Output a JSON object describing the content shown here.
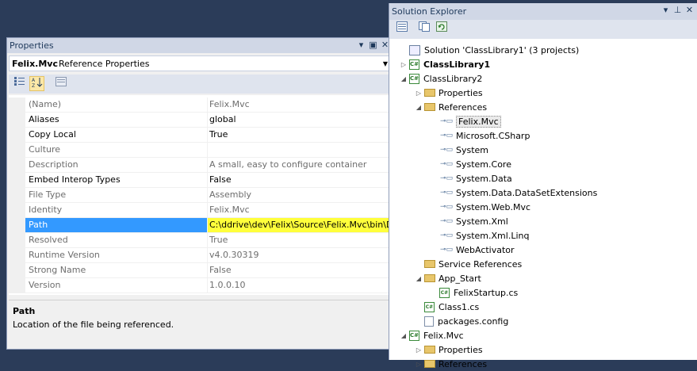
{
  "properties": {
    "title": "Properties",
    "window_buttons": [
      "▾",
      "▣",
      "✕"
    ],
    "object_name": "Felix.Mvc",
    "object_type": "Reference Properties",
    "rows": [
      {
        "name": "(Name)",
        "value": "Felix.Mvc",
        "readonly": true
      },
      {
        "name": "Aliases",
        "value": "global",
        "readonly": false
      },
      {
        "name": "Copy Local",
        "value": "True",
        "readonly": false
      },
      {
        "name": "Culture",
        "value": "",
        "readonly": true
      },
      {
        "name": "Description",
        "value": "A small, easy to configure container",
        "readonly": true
      },
      {
        "name": "Embed Interop Types",
        "value": "False",
        "readonly": false
      },
      {
        "name": "File Type",
        "value": "Assembly",
        "readonly": true
      },
      {
        "name": "Identity",
        "value": "Felix.Mvc",
        "readonly": true
      },
      {
        "name": "Path",
        "value": "C:\\ddrive\\dev\\Felix\\Source\\Felix.Mvc\\bin\\D",
        "readonly": true,
        "selected": true
      },
      {
        "name": "Resolved",
        "value": "True",
        "readonly": true
      },
      {
        "name": "Runtime Version",
        "value": "v4.0.30319",
        "readonly": true
      },
      {
        "name": "Strong Name",
        "value": "False",
        "readonly": true
      },
      {
        "name": "Version",
        "value": "1.0.0.10",
        "readonly": true
      }
    ],
    "description_title": "Path",
    "description_text": "Location of the file being referenced."
  },
  "solution_explorer": {
    "title": "Solution Explorer",
    "window_buttons": [
      "▾",
      "⊥",
      "✕"
    ],
    "items": [
      {
        "label": "Solution 'ClassLibrary1' (3 projects)",
        "indent": 0,
        "expander": "",
        "icon": "sol-i",
        "bold": false
      },
      {
        "label": "ClassLibrary1",
        "indent": 0,
        "expander": "▷",
        "icon": "proj",
        "bold": true
      },
      {
        "label": "ClassLibrary2",
        "indent": 0,
        "expander": "◢",
        "icon": "proj",
        "bold": false
      },
      {
        "label": "Properties",
        "indent": 1,
        "expander": "▷",
        "icon": "folder",
        "bold": false
      },
      {
        "label": "References",
        "indent": 1,
        "expander": "◢",
        "icon": "folder",
        "bold": false
      },
      {
        "label": "Felix.Mvc",
        "indent": 2,
        "expander": "",
        "icon": "ref",
        "bold": false,
        "selected": true
      },
      {
        "label": "Microsoft.CSharp",
        "indent": 2,
        "expander": "",
        "icon": "ref",
        "bold": false
      },
      {
        "label": "System",
        "indent": 2,
        "expander": "",
        "icon": "ref",
        "bold": false
      },
      {
        "label": "System.Core",
        "indent": 2,
        "expander": "",
        "icon": "ref",
        "bold": false
      },
      {
        "label": "System.Data",
        "indent": 2,
        "expander": "",
        "icon": "ref",
        "bold": false
      },
      {
        "label": "System.Data.DataSetExtensions",
        "indent": 2,
        "expander": "",
        "icon": "ref",
        "bold": false
      },
      {
        "label": "System.Web.Mvc",
        "indent": 2,
        "expander": "",
        "icon": "ref",
        "bold": false
      },
      {
        "label": "System.Xml",
        "indent": 2,
        "expander": "",
        "icon": "ref",
        "bold": false
      },
      {
        "label": "System.Xml.Linq",
        "indent": 2,
        "expander": "",
        "icon": "ref",
        "bold": false
      },
      {
        "label": "WebActivator",
        "indent": 2,
        "expander": "",
        "icon": "ref",
        "bold": false
      },
      {
        "label": "Service References",
        "indent": 1,
        "expander": "",
        "icon": "folder",
        "bold": false
      },
      {
        "label": "App_Start",
        "indent": 1,
        "expander": "◢",
        "icon": "folder",
        "bold": false
      },
      {
        "label": "FelixStartup.cs",
        "indent": 2,
        "expander": "",
        "icon": "cs",
        "bold": false
      },
      {
        "label": "Class1.cs",
        "indent": 1,
        "expander": "",
        "icon": "cs",
        "bold": false
      },
      {
        "label": "packages.config",
        "indent": 1,
        "expander": "",
        "icon": "cfg",
        "bold": false
      },
      {
        "label": "Felix.Mvc",
        "indent": 0,
        "expander": "◢",
        "icon": "proj",
        "bold": false
      },
      {
        "label": "Properties",
        "indent": 1,
        "expander": "▷",
        "icon": "folder",
        "bold": false
      },
      {
        "label": "References",
        "indent": 1,
        "expander": "▷",
        "icon": "folder",
        "bold": false
      }
    ]
  }
}
